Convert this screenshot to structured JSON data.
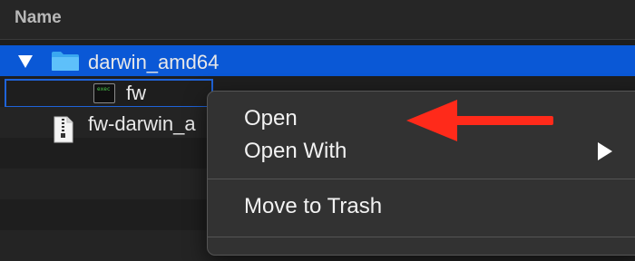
{
  "header": {
    "column_title": "Name"
  },
  "rows": [
    {
      "label": "darwin_amd64",
      "icon": "folder-icon",
      "disclosure": "expanded"
    },
    {
      "label": "fw",
      "icon": "executable-icon"
    },
    {
      "label": "fw-darwin_a",
      "icon": "archive-icon"
    }
  ],
  "context_menu": {
    "items": [
      {
        "label": "Open"
      },
      {
        "label": "Open With",
        "has_submenu": true
      },
      {
        "label": "Move to Trash"
      }
    ]
  },
  "annotation": {
    "arrow_color": "#ff2a1a",
    "points_to": "Open"
  },
  "colors": {
    "selection": "#0a58d6",
    "focus_ring": "#1f63d8",
    "folder": "#3aa7f0"
  }
}
